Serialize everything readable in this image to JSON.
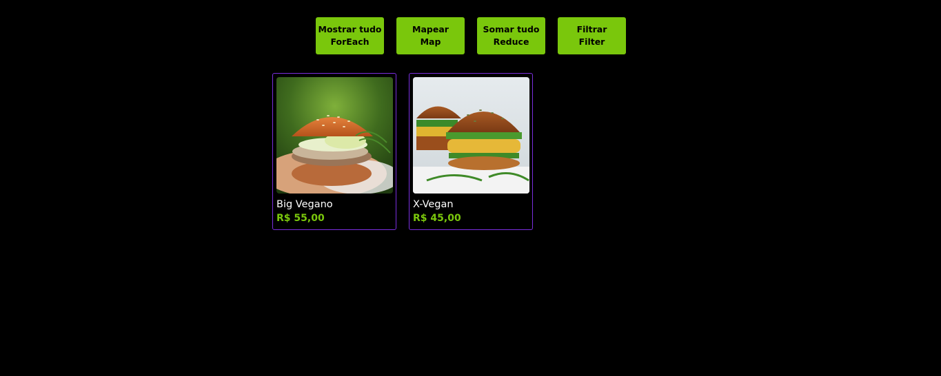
{
  "colors": {
    "background": "#000000",
    "accent": "#7ac70c",
    "card_border": "#7b2fe0",
    "text": "#ffffff"
  },
  "toolbar": {
    "buttons": [
      {
        "line1": "Mostrar tudo",
        "line2": "ForEach"
      },
      {
        "line1": "Mapear",
        "line2": "Map"
      },
      {
        "line1": "Somar tudo",
        "line2": "Reduce"
      },
      {
        "line1": "Filtrar",
        "line2": "Filter"
      }
    ]
  },
  "products": [
    {
      "name": "Big Vegano",
      "price": "R$ 55,00",
      "image": "burger-mushroom-photo"
    },
    {
      "name": "X-Vegan",
      "price": "R$ 45,00",
      "image": "burger-veggie-patty-photo"
    }
  ]
}
